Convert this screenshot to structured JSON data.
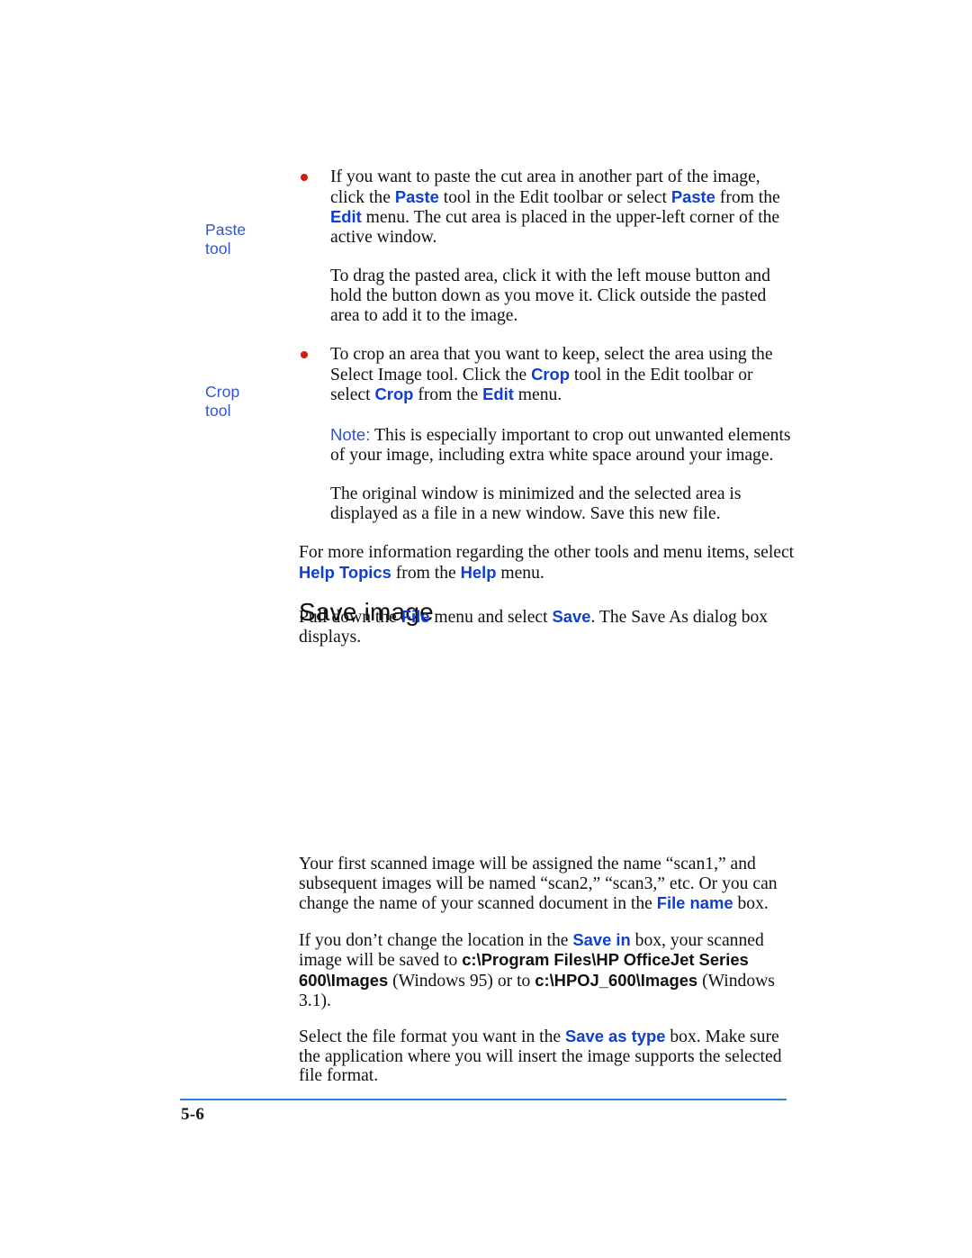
{
  "page": {
    "number_label": "5-6",
    "colors": {
      "ui_term_blue": "#0f3fd1",
      "margin_note_blue": "#3355cc",
      "note_label_blue": "#3352cc",
      "bullet_red": "#d81a0a",
      "footer_rule_blue": "#2e7fdb",
      "body_text": "#111111"
    }
  },
  "margin_notes": [
    {
      "line1": "Paste",
      "line2": "tool"
    },
    {
      "line1": "Crop",
      "line2": "tool"
    }
  ],
  "body": {
    "bullet_paste": {
      "p1_a": "If you want to paste the cut area in another part of the image, click the ",
      "term1": "Paste",
      "p1_b": " tool in the Edit toolbar or select ",
      "term2": "Paste",
      "p1_c": " from the ",
      "term3": "Edit",
      "p1_d": " menu. The cut area is placed in the upper-left corner of the active window."
    },
    "paste_drag": {
      "text": "To drag the pasted area, click it with the left mouse button and hold the button down as you move it. Click outside the pasted area to add it to the image."
    },
    "bullet_crop": {
      "p1_a": "To crop an area that you want to keep, select the area using the Select Image tool. Click the ",
      "term1": "Crop",
      "p1_b": " tool in the Edit toolbar or select ",
      "term2": "Crop",
      "p1_c": " from the ",
      "term3": "Edit",
      "p1_d": " menu."
    },
    "crop_note": {
      "label": "Note:",
      "text": " This is especially important to crop out unwanted elements of your image, including extra white space around your image."
    },
    "crop_result": {
      "text": "The original window is minimized and the selected area is displayed as a file in a new window. Save this new file."
    },
    "more_info": {
      "p1_a": "For more information regarding the other tools and menu items, select ",
      "term1": "Help Topics",
      "p1_b": " from the ",
      "term2": "Help",
      "p1_c": " menu."
    }
  },
  "save_image_section": {
    "heading": "Save image",
    "intro": {
      "p1_a": "Pull down the ",
      "term1": "File",
      "p1_b": " menu and select ",
      "term2": "Save",
      "p1_c": ". The Save As dialog box displays."
    },
    "naming": {
      "p1_a": "Your first scanned image will be assigned the name “scan1,” and subsequent images will be named “scan2,” “scan3,” etc. Or you can change the name of your scanned document in the ",
      "term1": "File name",
      "p1_b": " box."
    },
    "location": {
      "p1_a": "If you don’t change the location in the ",
      "term1": "Save in",
      "p1_b": " box, your scanned image will be saved to ",
      "path1": "c:\\Program Files\\HP OfficeJet Series 600\\Images",
      "p1_c": " (Windows 95) or to ",
      "path2": "c:\\HPOJ_600\\Images",
      "p1_d": " (Windows 3.1)."
    },
    "file_format": {
      "p1_a": "Select the file format you want in the ",
      "term1": "Save as type",
      "p1_b": " box. Make sure the application where you will insert the image supports the selected file format."
    }
  }
}
